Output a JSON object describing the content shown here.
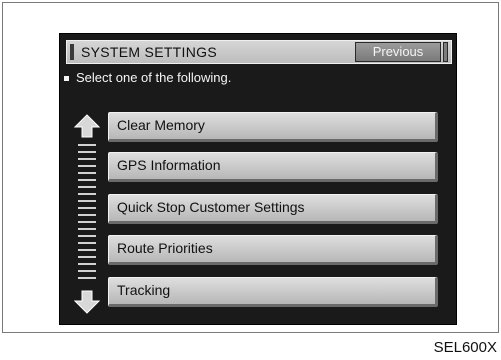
{
  "screen": {
    "title": "SYSTEM SETTINGS",
    "previous_label": "Previous",
    "instruction": "Select one of the following.",
    "menu_items": [
      {
        "label": "Clear Memory"
      },
      {
        "label": "GPS Information"
      },
      {
        "label": "Quick Stop Customer Settings"
      },
      {
        "label": "Route Priorities"
      },
      {
        "label": "Tracking"
      }
    ],
    "scroll_up_icon": "arrow-up-icon",
    "scroll_down_icon": "arrow-down-icon"
  },
  "figure_code": "SEL600X"
}
